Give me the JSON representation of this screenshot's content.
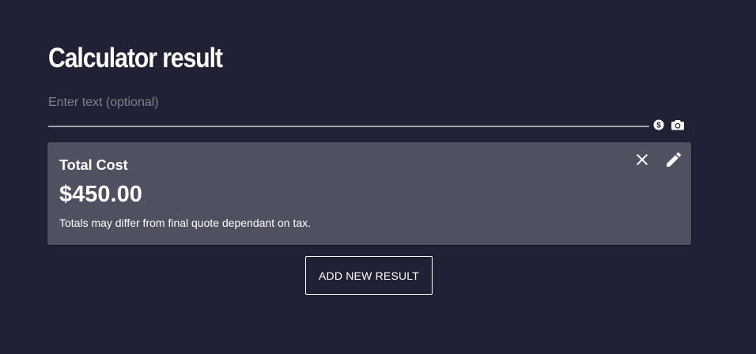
{
  "page": {
    "title": "Calculator result"
  },
  "input": {
    "value": "",
    "placeholder": "Enter text (optional)",
    "icons": [
      "dollar-icon",
      "camera-icon"
    ]
  },
  "result_card": {
    "label": "Total Cost",
    "amount": "$450.00",
    "note": "Totals may differ from final quote dependant on tax.",
    "actions": [
      "close-icon",
      "pencil-icon"
    ]
  },
  "add_button": {
    "label": "ADD NEW RESULT"
  },
  "colors": {
    "background": "#202134",
    "card": "#4f5161",
    "text": "#ffffff",
    "placeholder": "#80818d",
    "underline": "#a3a4ad"
  }
}
